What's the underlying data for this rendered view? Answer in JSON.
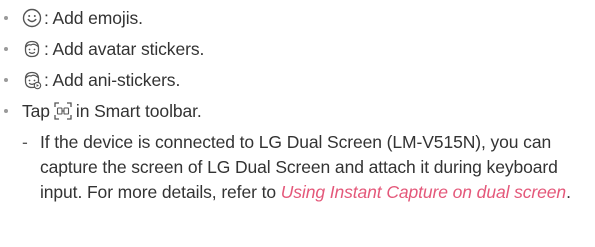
{
  "items": [
    {
      "icon": "smiley-face-icon",
      "text": ": Add emojis."
    },
    {
      "icon": "avatar-sticker-icon",
      "text": ": Add avatar stickers."
    },
    {
      "icon": "ani-sticker-icon",
      "text": ": Add ani-stickers."
    }
  ],
  "toolbar_item": {
    "prefix": "Tap",
    "icon": "instant-capture-icon",
    "suffix": "in Smart toolbar."
  },
  "sub_item": {
    "dash": "-",
    "text": "If the device is connected to LG Dual Screen (LM-V515N), you can capture the screen of LG Dual Screen and attach it during keyboard input. For more details, refer to ",
    "link": "Using Instant Capture on dual screen",
    "end": "."
  },
  "colors": {
    "text": "#333333",
    "bullet": "#9a9a9a",
    "link": "#e4587a"
  }
}
